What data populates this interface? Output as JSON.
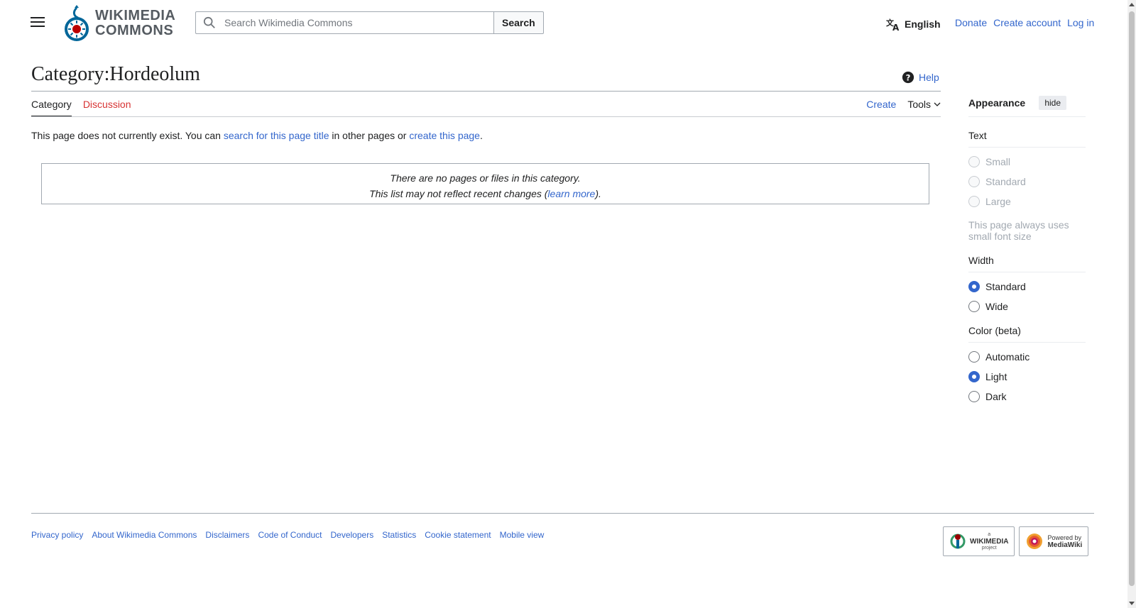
{
  "header": {
    "logo_line1": "WIKIMEDIA",
    "logo_line2": "COMMONS",
    "search_placeholder": "Search Wikimedia Commons",
    "search_button": "Search",
    "language": "English",
    "links": [
      "Donate",
      "Create account",
      "Log in"
    ]
  },
  "page": {
    "title": "Category:Hordeolum",
    "help": "Help",
    "tabs_left": [
      "Category",
      "Discussion"
    ],
    "tabs_right": {
      "create": "Create",
      "tools": "Tools"
    },
    "notice": {
      "prefix": "This page does not currently exist. You can ",
      "link1": "search for this page title",
      "middle": " in other pages or ",
      "link2": "create this page",
      "suffix": "."
    },
    "category_box": {
      "line1": "There are no pages or files in this category.",
      "line2_prefix": "This list may not reflect recent changes (",
      "line2_link": "learn more",
      "line2_suffix": ")."
    }
  },
  "appearance": {
    "title": "Appearance",
    "hide": "hide",
    "text_group": "Text",
    "text_options": [
      "Small",
      "Standard",
      "Large"
    ],
    "text_note": "This page always uses small font size",
    "width_group": "Width",
    "width_options": [
      "Standard",
      "Wide"
    ],
    "width_selected": "Standard",
    "color_group": "Color (beta)",
    "color_options": [
      "Automatic",
      "Light",
      "Dark"
    ],
    "color_selected": "Light"
  },
  "footer": {
    "links": [
      "Privacy policy",
      "About Wikimedia Commons",
      "Disclaimers",
      "Code of Conduct",
      "Developers",
      "Statistics",
      "Cookie statement",
      "Mobile view"
    ],
    "badge1_small": "a",
    "badge1_big": "WIKIMEDIA",
    "badge1_small2": "project",
    "badge2_small": "Powered by",
    "badge2_big": "MediaWiki"
  },
  "colors": {
    "link": "#3366cc",
    "red_link": "#d73333",
    "accent": "#3366cc"
  }
}
